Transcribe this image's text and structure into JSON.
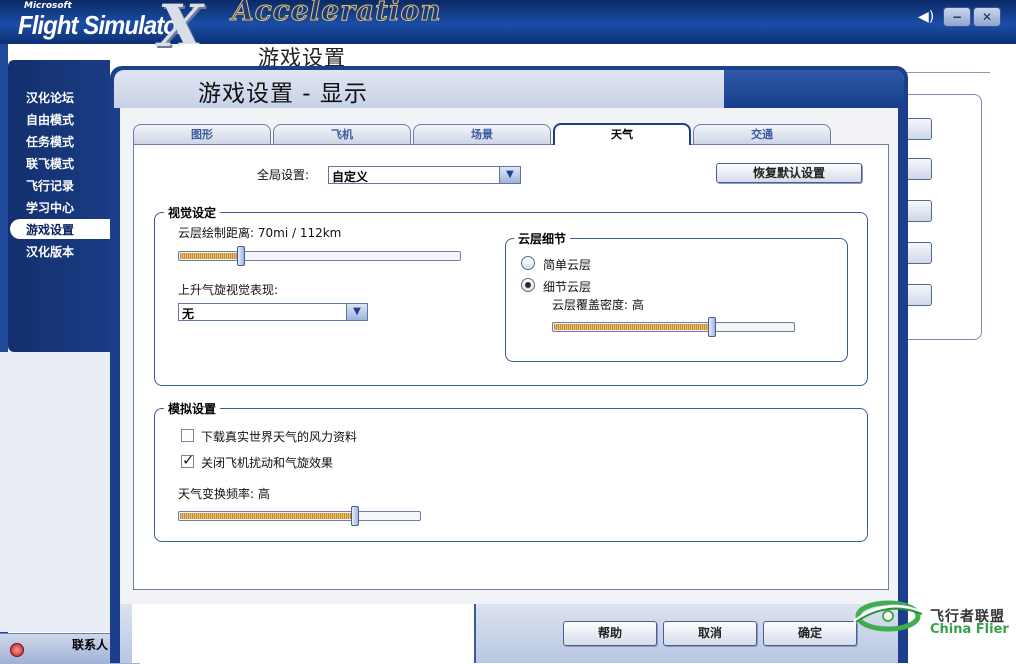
{
  "app": {
    "brand_small": "Microsoft",
    "brand_name": "Flight Simulator",
    "brand_x": "X",
    "brand_sub": "Acceleration",
    "bg_title": "游戏设置"
  },
  "sidebar": {
    "items": [
      {
        "label": "汉化论坛"
      },
      {
        "label": "自由模式"
      },
      {
        "label": "任务模式"
      },
      {
        "label": "联飞模式"
      },
      {
        "label": "飞行记录"
      },
      {
        "label": "学习中心"
      },
      {
        "label": "游戏设置"
      },
      {
        "label": "汉化版本"
      }
    ],
    "active_index": 6,
    "contact_label": "联系人"
  },
  "dialog": {
    "title": "游戏设置 - 显示",
    "tabs": [
      {
        "label": "图形"
      },
      {
        "label": "飞机"
      },
      {
        "label": "场景"
      },
      {
        "label": "天气"
      },
      {
        "label": "交通"
      }
    ],
    "active_tab": 3,
    "global": {
      "label": "全局设置:",
      "value": "自定义",
      "reset_label": "恢复默认设置"
    },
    "visual": {
      "legend": "视觉设定",
      "cloud_distance_label": "云层绘制距离:  70mi / 112km",
      "cloud_distance_level": 0.22,
      "thermal_label": "上升气旋视觉表现:",
      "thermal_value": "无"
    },
    "cloud_detail": {
      "legend": "云层细节",
      "simple_label": "简单云层",
      "detailed_label": "细节云层",
      "selected": "detailed",
      "coverage_label": "云层覆盖密度:  高",
      "coverage_level": 0.66
    },
    "simulation": {
      "legend": "模拟设置",
      "download_winds_label": "下载真实世界天气的风力资料",
      "download_winds_checked": false,
      "disable_turbulence_label": "关闭飞机扰动和气旋效果",
      "disable_turbulence_checked": true,
      "rate_label": "天气变换频率:  高",
      "rate_level": 0.73
    },
    "buttons": {
      "help": "帮助",
      "cancel": "取消",
      "ok": "确定"
    }
  },
  "watermark": {
    "cn": "飞行者联盟",
    "en": "China Flier"
  }
}
